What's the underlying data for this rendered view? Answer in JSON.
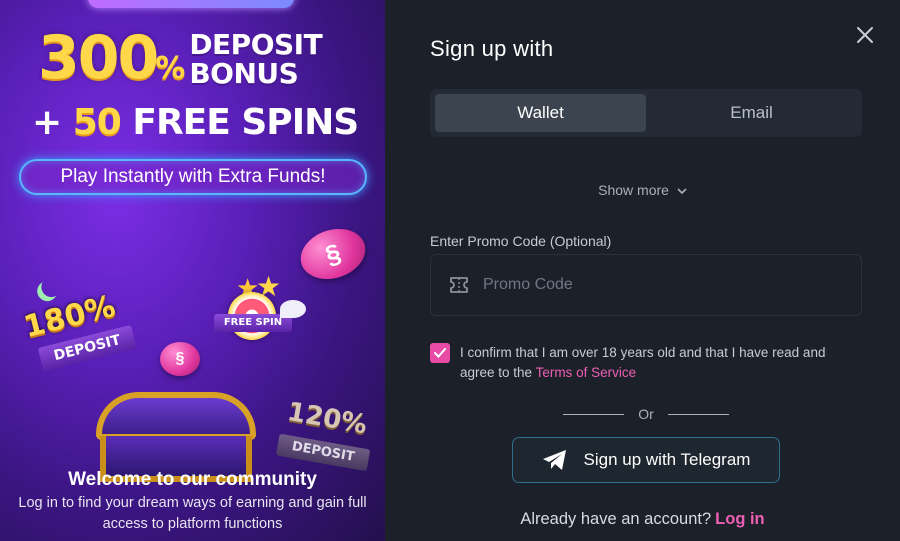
{
  "promo": {
    "headline_number": "300",
    "headline_percent": "%",
    "headline_line1a": "DEPOSIT",
    "headline_line1b": "BONUS",
    "headline_plus": "+ ",
    "headline_spins_num": "50",
    "headline_spins_text": " FREE SPINS",
    "pill_text": "Play Instantly with Extra Funds!",
    "badge_180": "180%",
    "badge_180_ribbon": "DEPOSIT",
    "badge_free_spin": "FREE SPIN",
    "badge_120": "120%",
    "badge_120_ribbon": "DEPOSIT",
    "welcome_title": "Welcome to our community",
    "welcome_sub": "Log in to find your dream ways of earning and gain full access to platform functions"
  },
  "form": {
    "title": "Sign up with",
    "tabs": [
      {
        "label": "Wallet",
        "active": true
      },
      {
        "label": "Email",
        "active": false
      }
    ],
    "show_more": "Show more",
    "promo_label": "Enter Promo Code (Optional)",
    "promo_placeholder": "Promo Code",
    "terms_checked": true,
    "terms_text": "I confirm that I am over 18 years old and that I have read and agree to the ",
    "terms_link": "Terms of Service",
    "or_text": "Or",
    "telegram_button": "Sign up with Telegram",
    "already_text": "Already have an account?",
    "login_link": "Log in"
  },
  "colors": {
    "accent_pink": "#ee5fb4",
    "panel_bg": "#1b2029",
    "promo_purple": "#5a1fb8"
  }
}
